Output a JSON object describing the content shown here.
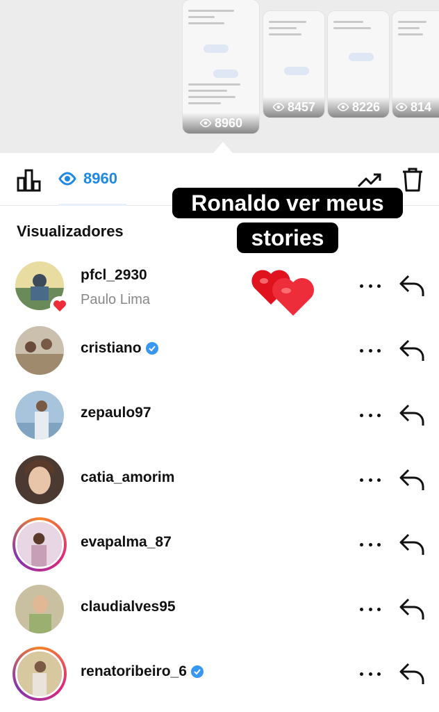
{
  "story_thumbnails": [
    {
      "views": "8960",
      "active": true
    },
    {
      "views": "8457",
      "active": false
    },
    {
      "views": "8226",
      "active": false
    },
    {
      "views": "814",
      "active": false
    }
  ],
  "stats": {
    "view_count": "8960"
  },
  "caption": {
    "line1": "Ronaldo ver meus",
    "line2": "stories"
  },
  "section_title": "Visualizadores",
  "viewers": [
    {
      "username": "pfcl_2930",
      "full_name": "Paulo Lima",
      "verified": false,
      "ring": false,
      "liked": true,
      "avatar_color": "#6a8a5a"
    },
    {
      "username": "cristiano",
      "full_name": "",
      "verified": true,
      "ring": false,
      "liked": false,
      "avatar_color": "#a08a6e"
    },
    {
      "username": "zepaulo97",
      "full_name": "",
      "verified": false,
      "ring": false,
      "liked": false,
      "avatar_color": "#7fa3c0"
    },
    {
      "username": "catia_amorim",
      "full_name": "",
      "verified": false,
      "ring": false,
      "liked": false,
      "avatar_color": "#8a6a5a"
    },
    {
      "username": "evapalma_87",
      "full_name": "",
      "verified": false,
      "ring": true,
      "liked": false,
      "avatar_color": "#c7a0b8"
    },
    {
      "username": "claudialves95",
      "full_name": "",
      "verified": false,
      "ring": false,
      "liked": false,
      "avatar_color": "#9bb070"
    },
    {
      "username": "renatoribeiro_6",
      "full_name": "",
      "verified": true,
      "ring": true,
      "liked": false,
      "avatar_color": "#b79a6a"
    }
  ],
  "colors": {
    "accent_blue": "#1e88e5",
    "heart_red": "#ed2d3a",
    "verified_blue": "#3897f0"
  }
}
